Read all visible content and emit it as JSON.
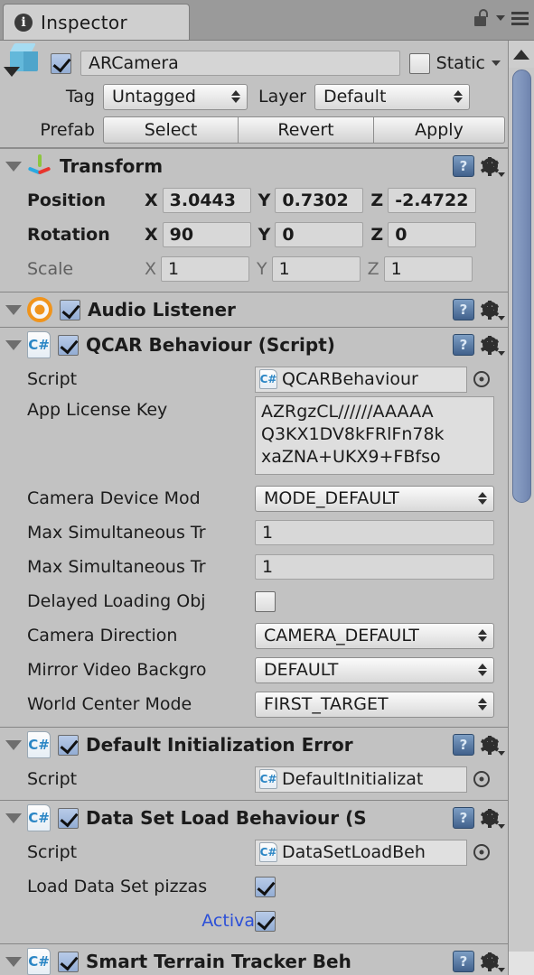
{
  "window": {
    "tab_label": "Inspector",
    "tab_icon": "info-icon",
    "lock_icon": "lock-icon",
    "menu_icon": "hamburger-menu-icon"
  },
  "object_header": {
    "enabled": true,
    "name": "ARCamera",
    "static_label": "Static",
    "static_checked": false,
    "tag_label": "Tag",
    "tag_value": "Untagged",
    "layer_label": "Layer",
    "layer_value": "Default",
    "prefab_label": "Prefab",
    "prefab_buttons": [
      "Select",
      "Revert",
      "Apply"
    ]
  },
  "components": [
    {
      "title": "Transform",
      "icon": "transform-axis-icon",
      "has_checkbox": false,
      "rows": [
        {
          "label": "Position",
          "bold": true,
          "axes": [
            {
              "axis": "X",
              "value": "3.0443"
            },
            {
              "axis": "Y",
              "value": "0.7302"
            },
            {
              "axis": "Z",
              "value": "-2.4722"
            }
          ]
        },
        {
          "label": "Rotation",
          "bold": true,
          "axes": [
            {
              "axis": "X",
              "value": "90"
            },
            {
              "axis": "Y",
              "value": "0"
            },
            {
              "axis": "Z",
              "value": "0"
            }
          ]
        },
        {
          "label": "Scale",
          "bold": false,
          "axes": [
            {
              "axis": "X",
              "value": "1"
            },
            {
              "axis": "Y",
              "value": "1"
            },
            {
              "axis": "Z",
              "value": "1"
            }
          ]
        }
      ]
    },
    {
      "title": "Audio Listener",
      "icon": "audio-listener-icon",
      "has_checkbox": true,
      "enabled": true
    },
    {
      "title": "QCAR Behaviour (Script)",
      "icon": "csharp-script-icon",
      "has_checkbox": true,
      "enabled": true,
      "script_label": "Script",
      "script_value": "QCARBehaviour",
      "license_label": "App License Key",
      "license_lines": "AZRgzCL//////AAAAA\nQ3KX1DV8kFRlFn78k\nxaZNA+UKX9+FBfso",
      "camera_device_mode_label": "Camera Device Mod",
      "camera_device_mode_value": "MODE_DEFAULT",
      "max_trackables_label_1": "Max Simultaneous Tr",
      "max_trackables_value_1": "1",
      "max_trackables_label_2": "Max Simultaneous Tr",
      "max_trackables_value_2": "1",
      "delayed_loading_label": "Delayed Loading Obj",
      "delayed_loading_checked": false,
      "camera_direction_label": "Camera Direction",
      "camera_direction_value": "CAMERA_DEFAULT",
      "mirror_video_label": "Mirror Video Backgro",
      "mirror_video_value": "DEFAULT",
      "world_center_label": "World Center Mode",
      "world_center_value": "FIRST_TARGET"
    },
    {
      "title": "Default Initialization Error",
      "icon": "csharp-script-icon",
      "has_checkbox": true,
      "enabled": true,
      "script_label": "Script",
      "script_value": "DefaultInitializat"
    },
    {
      "title": "Data Set Load Behaviour (S",
      "icon": "csharp-script-icon",
      "has_checkbox": true,
      "enabled": true,
      "script_label": "Script",
      "script_value": "DataSetLoadBeh",
      "load_dataset_label": "Load Data Set pizzas",
      "load_dataset_checked": true,
      "activate_label": "Activa",
      "activate_checked": true
    },
    {
      "title": "Smart Terrain Tracker Beh",
      "icon": "csharp-script-icon",
      "has_checkbox": true,
      "enabled": true
    }
  ],
  "icons": {
    "help": "?",
    "gear": "gear-icon",
    "csharp": "C#"
  }
}
